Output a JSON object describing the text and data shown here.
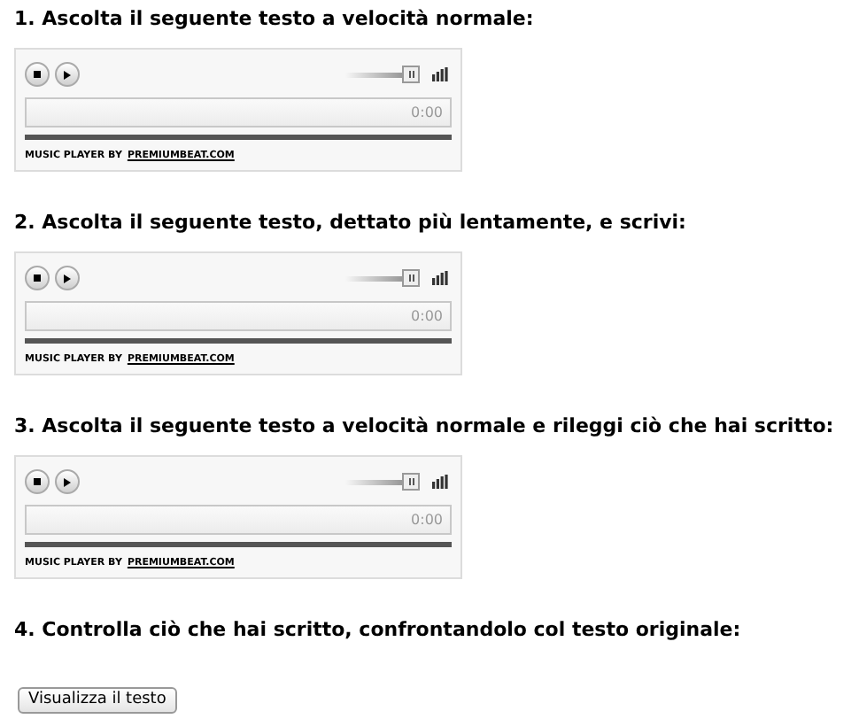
{
  "sections": [
    {
      "heading": "1. Ascolta il seguente testo a velocità normale:",
      "player": {
        "time": "0:00",
        "credit_prefix": "MUSIC PLAYER BY",
        "credit_link": "PREMIUMBEAT.COM"
      }
    },
    {
      "heading": "2. Ascolta il seguente testo, dettato più lentamente, e scrivi:",
      "player": {
        "time": "0:00",
        "credit_prefix": "MUSIC PLAYER BY",
        "credit_link": "PREMIUMBEAT.COM"
      }
    },
    {
      "heading": "3. Ascolta il seguente testo a velocità normale e rileggi ciò che hai scritto:",
      "player": {
        "time": "0:00",
        "credit_prefix": "MUSIC PLAYER BY",
        "credit_link": "PREMIUMBEAT.COM"
      }
    },
    {
      "heading": "4. Controlla ciò che hai scritto, confrontandolo col testo originale:"
    }
  ],
  "button": "Visualizza il testo"
}
